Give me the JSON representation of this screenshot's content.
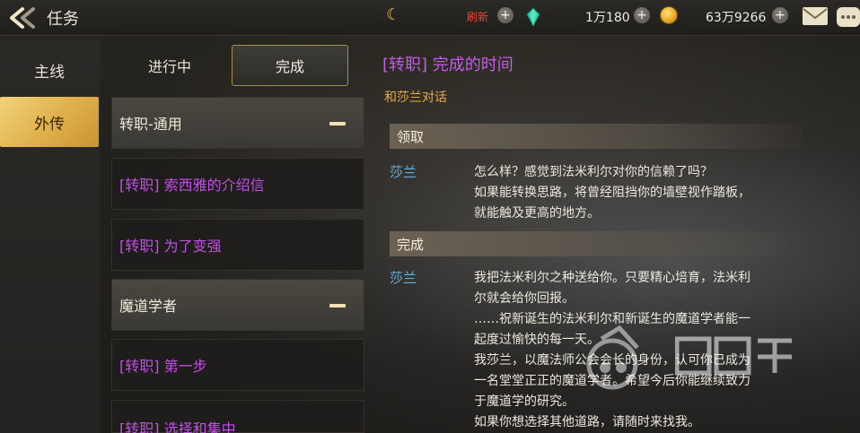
{
  "header": {
    "title": "任务",
    "refresh_label": "刷新",
    "currency_gems": "1万180",
    "currency_gold": "63万9266",
    "icons": {
      "back": "back-arrow-icon",
      "moon": "moon-icon",
      "gem": "gem-icon",
      "coin": "coin-icon",
      "mail": "mail-icon",
      "chat": "chat-icon"
    }
  },
  "sidebar": {
    "tabs": [
      {
        "label": "主线"
      },
      {
        "label": "外传"
      }
    ]
  },
  "subtabs": [
    {
      "label": "进行中"
    },
    {
      "label": "完成"
    }
  ],
  "quests": [
    {
      "label": "转职-通用"
    },
    {
      "label": "[转职] 索西雅的介绍信"
    },
    {
      "label": "[转职] 为了变强"
    },
    {
      "label": "魔道学者"
    },
    {
      "label": "[转职] 第一步"
    },
    {
      "label": "[转职] 选择和集中"
    }
  ],
  "detail": {
    "title": "[转职] 完成的时间",
    "subtitle": "和莎兰对话",
    "section_accept": "领取",
    "section_complete": "完成",
    "speaker": "莎兰",
    "accept_lines": [
      "怎么样？感觉到法米利尔对你的信赖了吗？",
      "如果能转换思路，将曾经阻挡你的墙壁视作踏板，",
      "就能触及更高的地方。"
    ],
    "complete_lines": [
      "我把法米利尔之种送给你。只要精心培育，法米利",
      "尔就会给你回报。",
      "……祝新诞生的法米利尔和新诞生的魔道学者能一",
      "起度过愉快的每一天。",
      "我莎兰，以魔法师公会会长的身份，认可你已成为",
      "一名堂堂正正的魔道学者。希望今后你能继续致力",
      "于魔道学的研究。",
      "如果你想选择其他道路，请随时来找我。"
    ]
  },
  "watermark": {
    "text": "游戏头条"
  }
}
